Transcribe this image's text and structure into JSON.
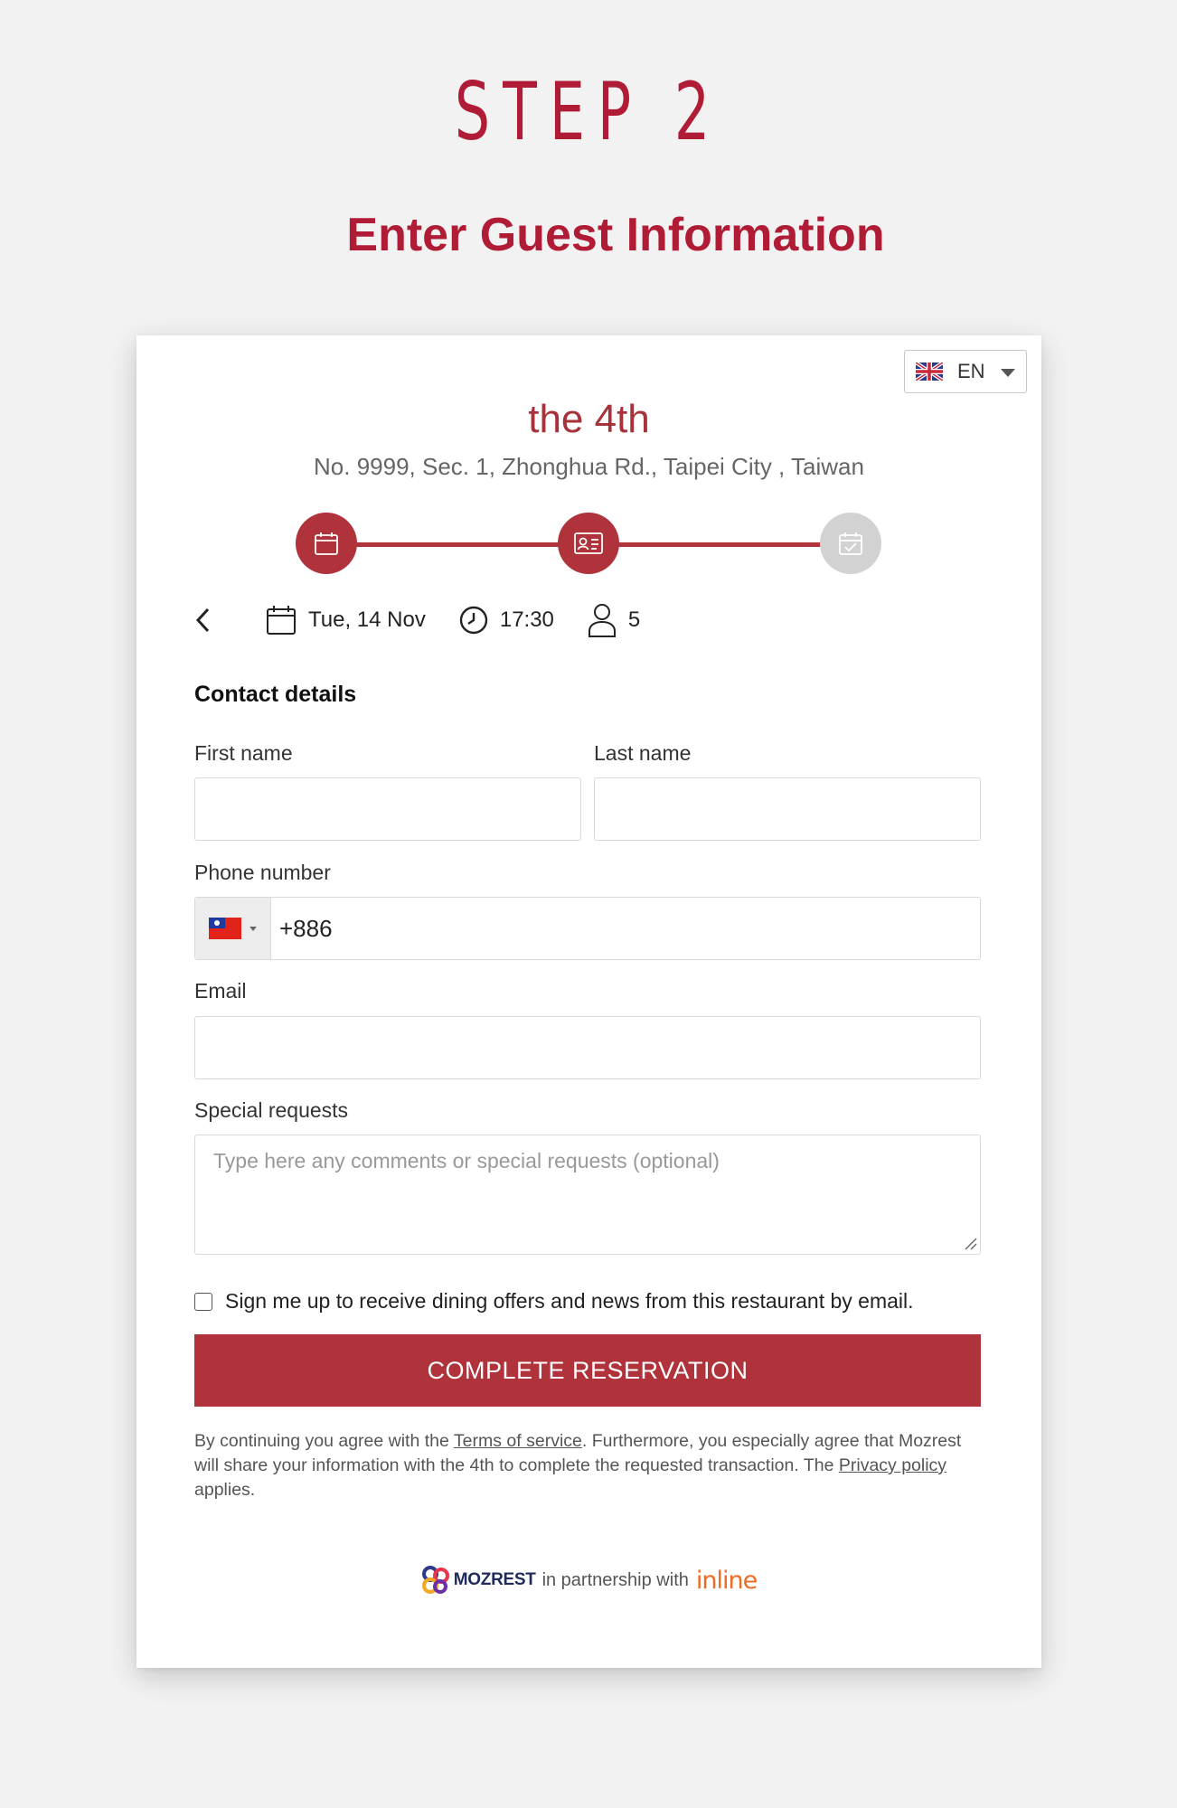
{
  "header": {
    "step": "STEP 2",
    "subtitle": "Enter Guest Information"
  },
  "language": {
    "code": "EN",
    "icon": "uk-flag-icon"
  },
  "restaurant": {
    "name": "the 4th",
    "address": "No. 9999, Sec. 1, Zhonghua Rd., Taipei City , Taiwan"
  },
  "progress": {
    "steps": [
      {
        "icon": "calendar-icon",
        "state": "completed"
      },
      {
        "icon": "contact-card-icon",
        "state": "current"
      },
      {
        "icon": "calendar-check-icon",
        "state": "pending"
      }
    ],
    "active_color": "#b0323b",
    "inactive_color": "#d2d2d2"
  },
  "booking": {
    "date": "Tue, 14 Nov",
    "time": "17:30",
    "guests": "5"
  },
  "form": {
    "section_title": "Contact details",
    "first_name_label": "First name",
    "first_name_value": "",
    "last_name_label": "Last name",
    "last_name_value": "",
    "phone_label": "Phone number",
    "phone_country": "taiwan-flag-icon",
    "phone_value": "+886",
    "email_label": "Email",
    "email_value": "",
    "requests_label": "Special requests",
    "requests_placeholder": "Type here any comments or special requests (optional)",
    "newsletter_label": "Sign me up to receive dining offers and news from this restaurant by email.",
    "newsletter_checked": false,
    "submit_label": "COMPLETE RESERVATION"
  },
  "legal": {
    "part1": "By continuing you agree with the ",
    "terms_link": "Terms of service",
    "part2": ". Furthermore, you especially agree that Mozrest will share your information with the 4th to complete the requested transaction. The ",
    "privacy_link": "Privacy policy",
    "part3": " applies."
  },
  "footer": {
    "brand": "MOZREST",
    "partnership": "in partnership with",
    "partner": "inline"
  },
  "colors": {
    "brand_red": "#b01c35",
    "button_red": "#b0323b",
    "inline_orange": "#ef6b23"
  }
}
